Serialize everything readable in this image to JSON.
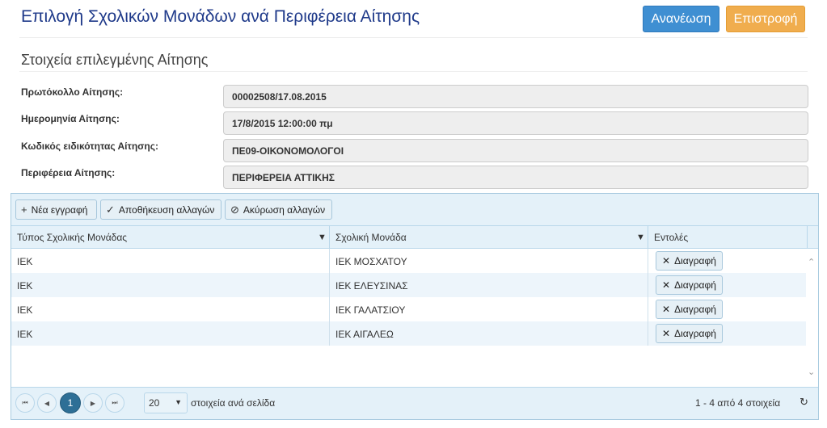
{
  "header": {
    "title": "Επιλογή Σχολικών Μονάδων ανά Περιφέρεια Αίτησης",
    "refresh_label": "Ανανέωση",
    "back_label": "Επιστροφή"
  },
  "details": {
    "section_title": "Στοιχεία επιλεγμένης Αίτησης",
    "fields": [
      {
        "label": "Πρωτόκολλο Αίτησης:",
        "value": "00002508/17.08.2015"
      },
      {
        "label": "Ημερομηνία Αίτησης:",
        "value": "17/8/2015 12:00:00 πμ"
      },
      {
        "label": "Κωδικός ειδικότητας Αίτησης:",
        "value": "ΠΕ09-ΟΙΚΟΝΟΜΟΛΟΓΟΙ"
      },
      {
        "label": "Περιφέρεια Αίτησης:",
        "value": "ΠΕΡΙΦΕΡΕΙΑ ΑΤΤΙΚΗΣ"
      }
    ]
  },
  "grid": {
    "toolbar": {
      "new_label": "Νέα εγγραφή",
      "save_label": "Αποθήκευση αλλαγών",
      "cancel_label": "Ακύρωση αλλαγών"
    },
    "columns": [
      "Τύπος Σχολικής Μονάδας",
      "Σχολική Μονάδα",
      "Εντολές"
    ],
    "rows": [
      {
        "type": "ΙΕΚ",
        "unit": "ΙΕΚ ΜΟΣΧΑΤΟΥ",
        "action": "Διαγραφή"
      },
      {
        "type": "ΙΕΚ",
        "unit": "ΙΕΚ ΕΛΕΥΣΙΝΑΣ",
        "action": "Διαγραφή"
      },
      {
        "type": "ΙΕΚ",
        "unit": "ΙΕΚ ΓΑΛΑΤΣΙΟΥ",
        "action": "Διαγραφή"
      },
      {
        "type": "ΙΕΚ",
        "unit": "ΙΕΚ ΑΙΓΑΛΕΩ",
        "action": "Διαγραφή"
      }
    ],
    "pager": {
      "current_page": "1",
      "page_size": "20",
      "page_size_label": "στοιχεία ανά σελίδα",
      "info": "1 - 4 από 4 στοιχεία"
    }
  },
  "icons": {
    "filter": "funnel-icon",
    "delete": "x-icon",
    "add": "plus-icon",
    "save": "check-icon",
    "cancel": "cancel-circle-icon",
    "refresh": "refresh-icon"
  },
  "colors": {
    "title": "#1f3a8a",
    "refresh_button": "#3f8fd2",
    "back_button": "#f0ad4e",
    "grid_header": "#e4f1f9",
    "current_page": "#2e6f96"
  }
}
